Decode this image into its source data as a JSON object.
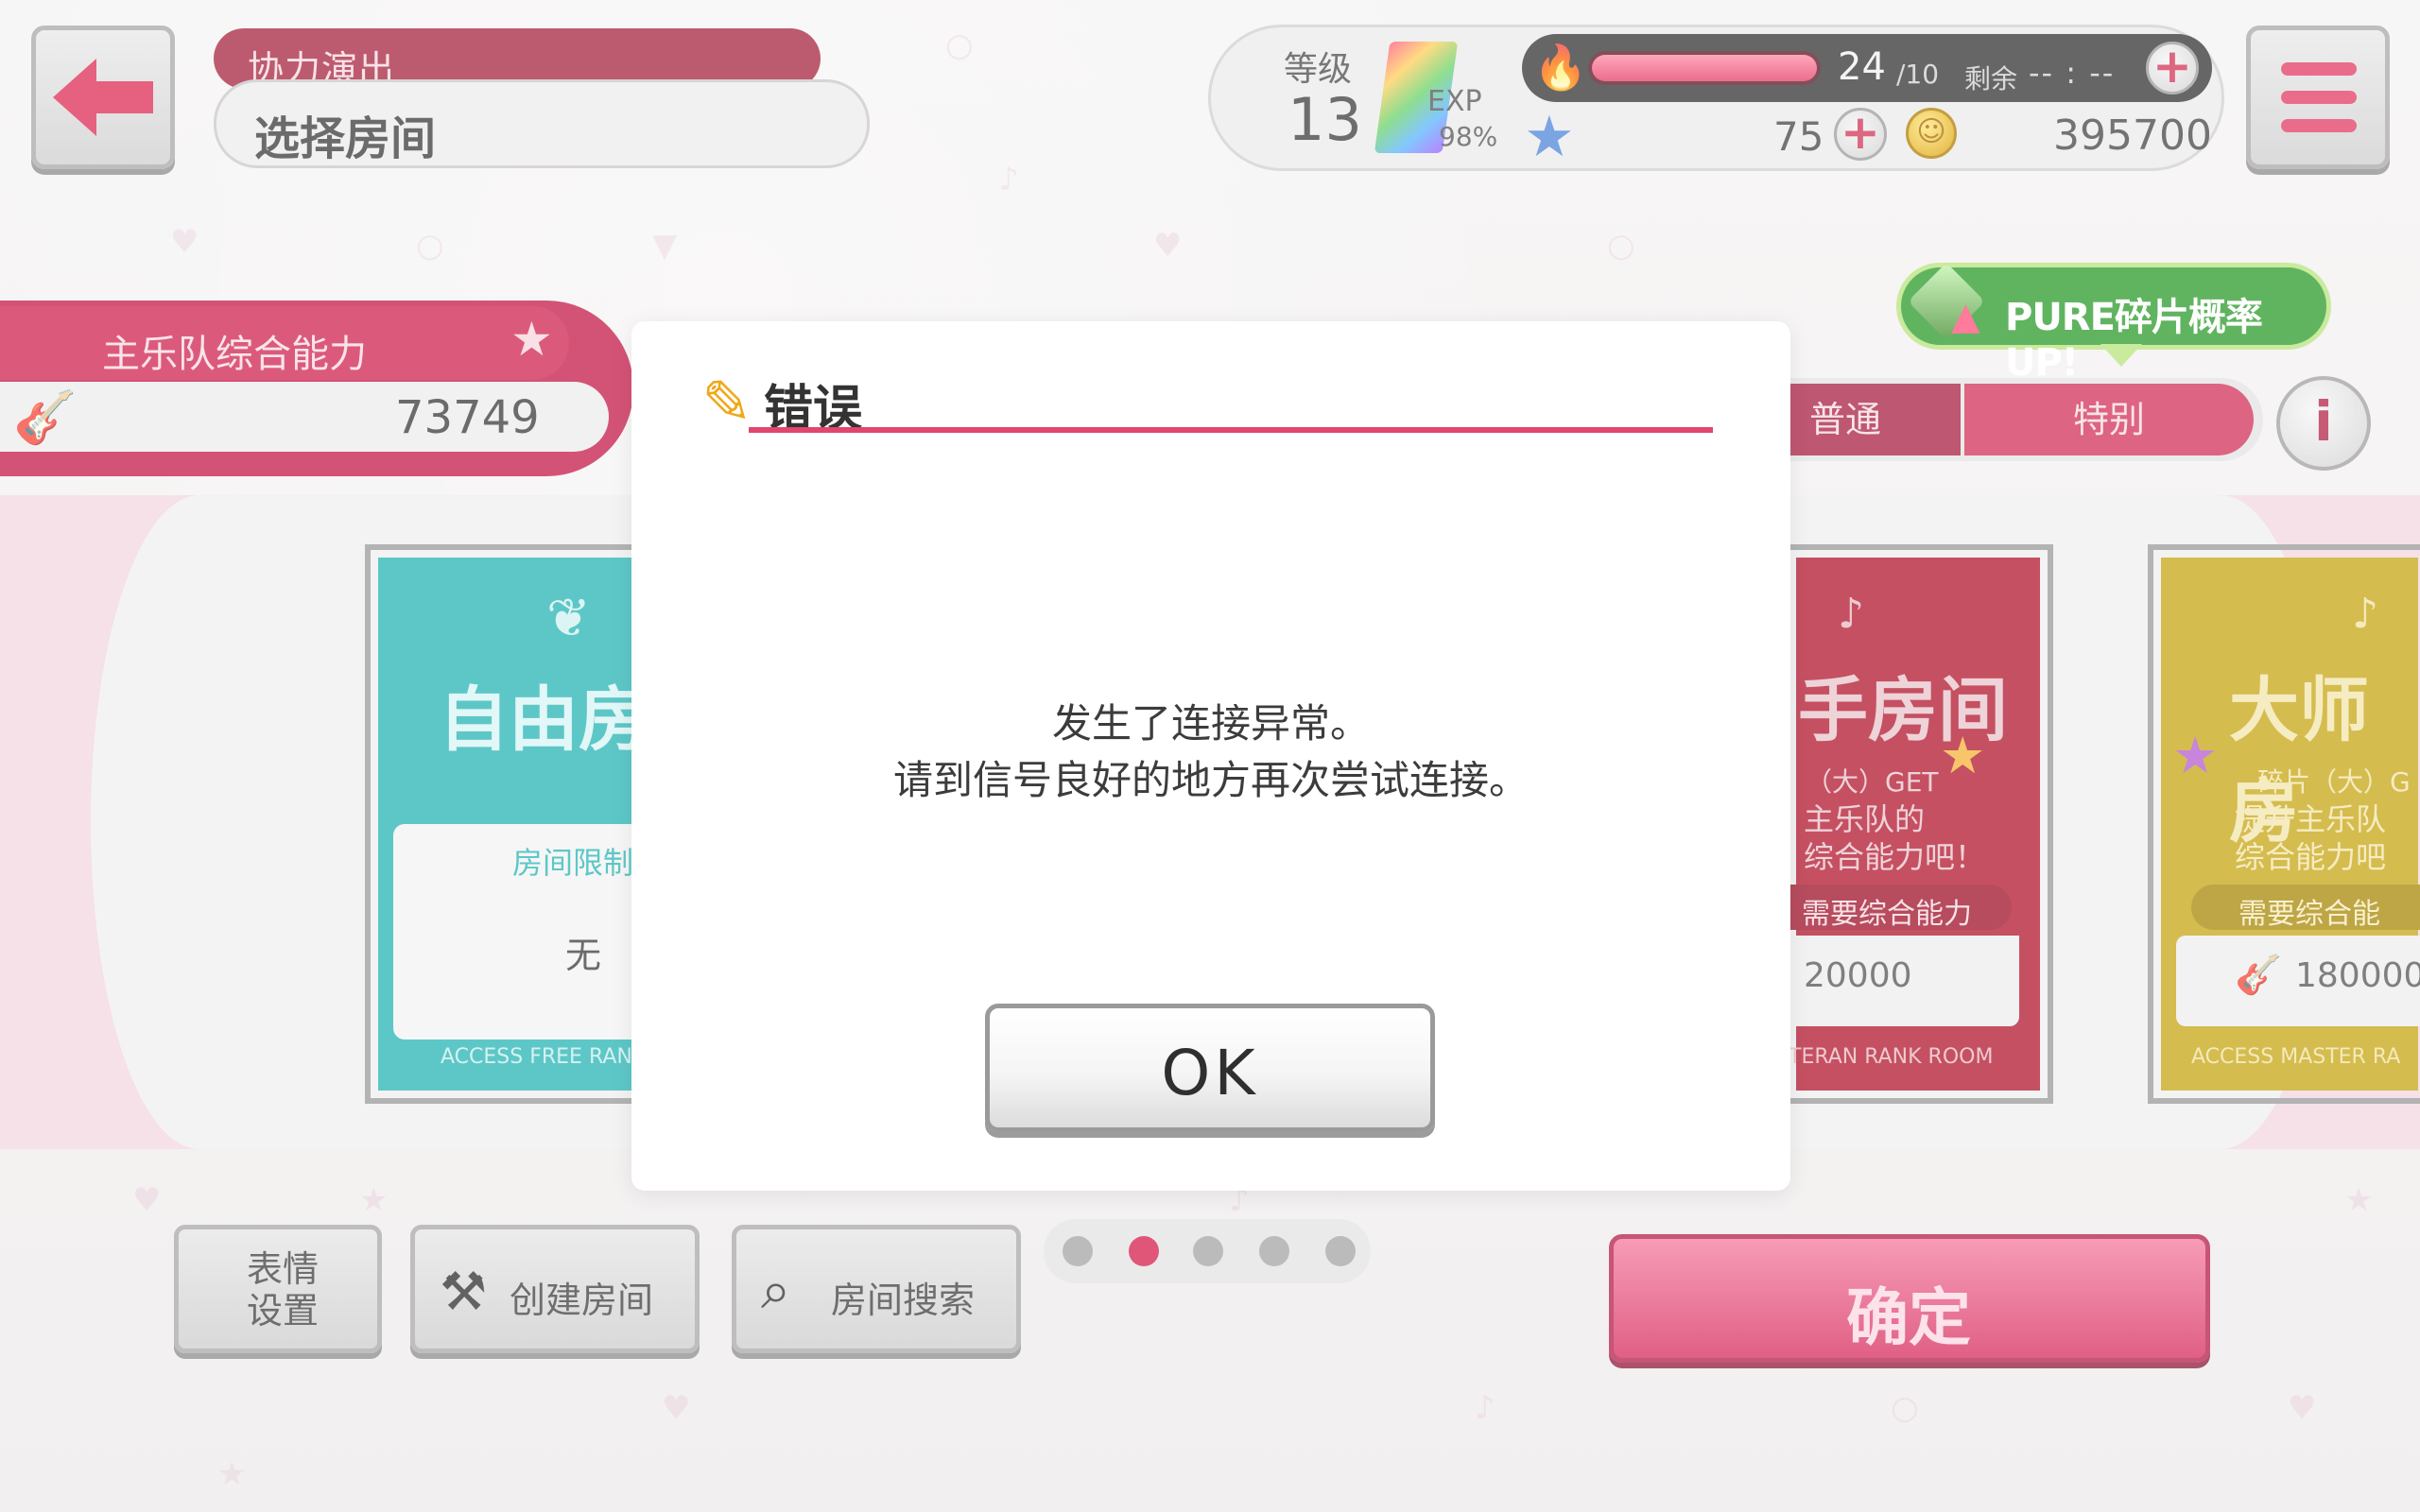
{
  "header": {
    "mode_label": "协力演出",
    "screen_title": "选择房间"
  },
  "status": {
    "level_label": "等级",
    "level": "13",
    "exp_label": "EXP",
    "exp_percent": "98%",
    "stamina_current": "24",
    "stamina_max": "/10",
    "stamina_fill_ratio": 1.0,
    "remaining_label": "剩余",
    "remaining_time": "-- : --",
    "star_count": "75",
    "coin_count": "395700"
  },
  "band_power": {
    "label": "主乐队综合能力",
    "value": "73749"
  },
  "pure_badge": {
    "text": "PURE碎片概率UP!"
  },
  "tabs": [
    {
      "label": "普通",
      "selected": false
    },
    {
      "label": "特别",
      "selected": true
    }
  ],
  "rooms": {
    "free": {
      "title": "自由房",
      "limit_label": "房间限制",
      "limit_value": "无",
      "footer": "ACCESS FREE RAN"
    },
    "expert": {
      "title": "手房间",
      "line1": "（大）GET",
      "line2": "主乐队的",
      "line3": "综合能力吧！",
      "requirement_label": "需要综合能力",
      "requirement_value": "20000",
      "footer": "TERAN RANK ROOM"
    },
    "master": {
      "title": "大师房",
      "line1": "碎片（大）G",
      "line2": "提升主乐队",
      "line3": "综合能力吧",
      "requirement_label": "需要综合能",
      "requirement_value": "180000",
      "footer": "ACCESS MASTER RA"
    }
  },
  "bottom": {
    "emotion_label": "表情设置",
    "create_room_label": "创建房间",
    "search_room_label": "房间搜索",
    "confirm_label": "确定",
    "page_count": 5,
    "active_page": 2
  },
  "dialog": {
    "title": "错误",
    "message_line1": "发生了连接异常。",
    "message_line2": "请到信号良好的地方再次尝试连接。",
    "ok_label": "OK"
  },
  "colors": {
    "accent_pink": "#d23158",
    "dark_pink": "#a6253f",
    "teal": "#27b4b5",
    "expert_red": "#b2162e",
    "master_gold": "#c7a614",
    "pure_green": "#2b9b2b"
  }
}
